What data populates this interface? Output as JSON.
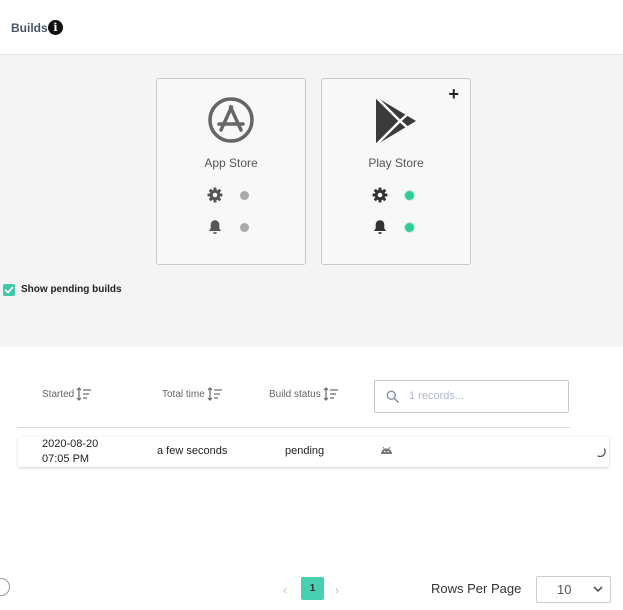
{
  "header": {
    "title": "Builds",
    "info_icon": "i"
  },
  "stores": [
    {
      "name": "App Store",
      "icon": "app-store-icon",
      "build_config_status": "grey",
      "notification_status": "grey"
    },
    {
      "name": "Play Store",
      "icon": "play-store-icon",
      "build_config_status": "green",
      "notification_status": "green",
      "action": "+"
    }
  ],
  "filters": {
    "show_pending_label": "Show pending builds",
    "show_pending_checked": true
  },
  "table": {
    "columns": [
      "Started",
      "Total time",
      "Build status"
    ],
    "search_placeholder": "1 records...",
    "rows": [
      {
        "started_date": "2020-08-20",
        "started_time": "07:05 PM",
        "total_time": "a few seconds",
        "status": "pending",
        "platform_icon": "android-icon"
      }
    ]
  },
  "pagination": {
    "prev": "‹",
    "current_page": "1",
    "next": "›",
    "rows_per_page_label": "Rows Per Page",
    "rows_per_page_value": "10"
  },
  "colors": {
    "accent": "#49d0b0",
    "status_green": "#2ecc9a",
    "status_grey": "#aaaaaa"
  }
}
